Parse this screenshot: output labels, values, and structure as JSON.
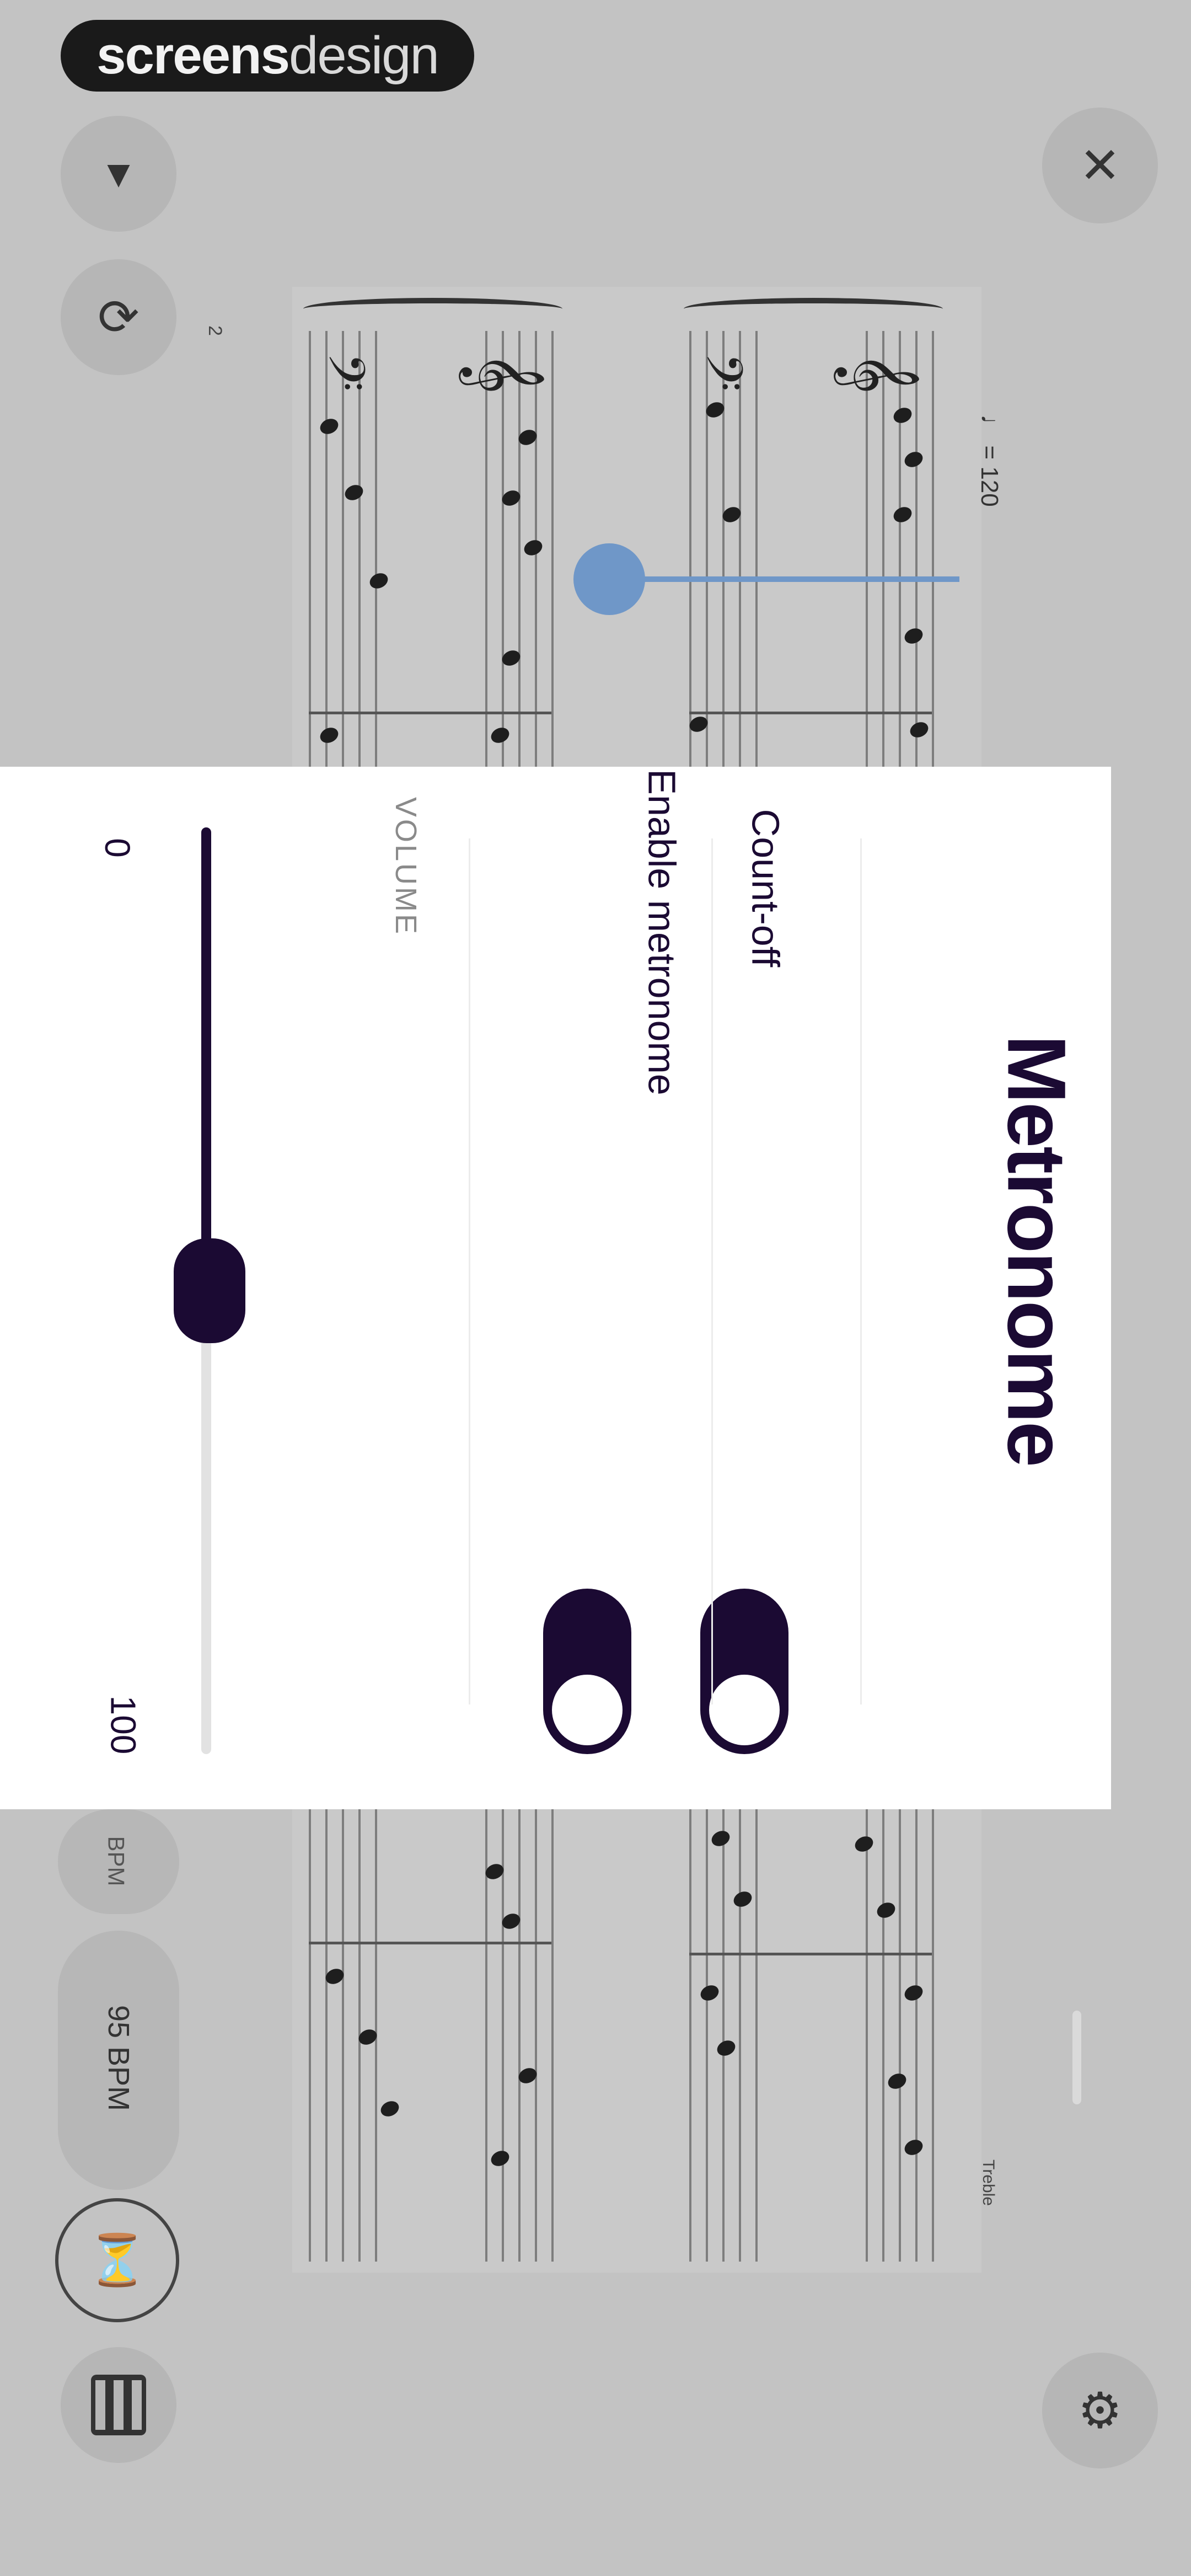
{
  "brand": {
    "part1": "screens",
    "part2": "design"
  },
  "score": {
    "tempo_marking": "♩ = 120",
    "measure_number": "2",
    "footer_text": "Treble"
  },
  "modal": {
    "title": "Metronome",
    "count_off_label": "Count-off",
    "count_off_on": true,
    "enable_label": "Enable metronome",
    "enable_on": true,
    "volume_label": "VOLUME",
    "volume_min": "0",
    "volume_max": "100",
    "volume_value": 50
  },
  "toolbar": {
    "bpm_label": "95 BPM",
    "partial_label": "BPM"
  },
  "colors": {
    "accent": "#1b0a33",
    "playhead": "#6f97c8",
    "backdrop": "#c3c3c3"
  }
}
